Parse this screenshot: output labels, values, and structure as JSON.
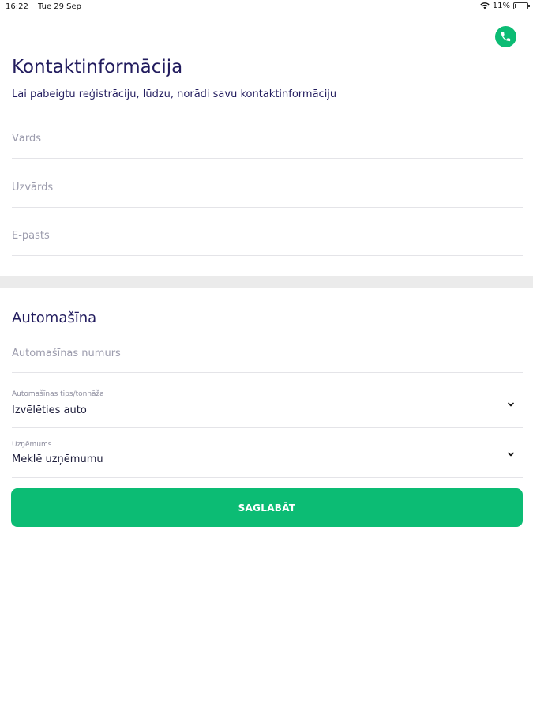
{
  "status_bar": {
    "time": "16:22",
    "date": "Tue 29 Sep",
    "battery_percent": "11%",
    "battery_level": 0.11
  },
  "contact": {
    "title": "Kontaktinformācija",
    "subtitle": "Lai pabeigtu reģistrāciju, lūdzu, norādi savu kontaktinformāciju",
    "first_name_placeholder": "Vārds",
    "last_name_placeholder": "Uzvārds",
    "email_placeholder": "E-pasts"
  },
  "car": {
    "title": "Automašīna",
    "plate_placeholder": "Automašīnas numurs",
    "type_label": "Automašīnas tips/tonnāža",
    "type_value": "Izvēlēties auto",
    "company_label": "Uzņēmums",
    "company_value": "Meklē uzņēmumu"
  },
  "actions": {
    "save_label": "SAGLABĀT"
  },
  "colors": {
    "accent": "#0cbc74",
    "heading": "#221c5e",
    "placeholder": "#9c9cad",
    "divider": "#ebebeb"
  },
  "icons": [
    "wifi-icon",
    "battery-icon",
    "phone-icon",
    "chevron-down-icon"
  ]
}
